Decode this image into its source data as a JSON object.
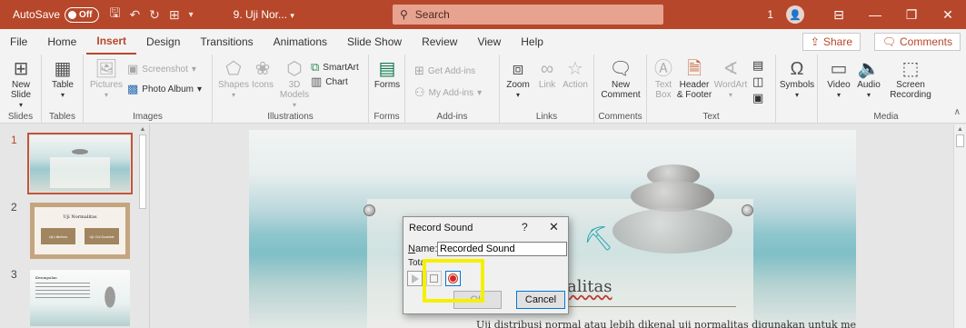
{
  "titlebar": {
    "autosave_label": "AutoSave",
    "autosave_state": "Off",
    "doc_title": "9. Uji Nor...",
    "search_placeholder": "Search",
    "notification_count": "1",
    "bg_color": "#b7472a"
  },
  "tabs": [
    "File",
    "Home",
    "Insert",
    "Design",
    "Transitions",
    "Animations",
    "Slide Show",
    "Review",
    "View",
    "Help"
  ],
  "active_tab": "Insert",
  "share_label": "Share",
  "comments_label": "Comments",
  "ribbon": {
    "groups": {
      "slides": "Slides",
      "tables": "Tables",
      "images": "Images",
      "illustrations": "Illustrations",
      "forms": "Forms",
      "addins": "Add-ins",
      "links": "Links",
      "comments": "Comments",
      "text": "Text",
      "media": "Media"
    },
    "new_slide": "New Slide",
    "table": "Table",
    "pictures": "Pictures",
    "screenshot": "Screenshot",
    "photo_album": "Photo Album",
    "shapes": "Shapes",
    "icons": "Icons",
    "models_3d": "3D Models",
    "smartart": "SmartArt",
    "chart": "Chart",
    "forms": "Forms",
    "get_addins": "Get Add-ins",
    "my_addins": "My Add-ins",
    "zoom": "Zoom",
    "link": "Link",
    "action": "Action",
    "new_comment": "New Comment",
    "text_box": "Text Box",
    "header_footer": "Header & Footer",
    "wordart": "WordArt",
    "symbols": "Symbols",
    "video": "Video",
    "audio": "Audio",
    "screen_recording": "Screen Recording"
  },
  "slides_pane": {
    "numbers": [
      "1",
      "2",
      "3"
    ],
    "thumb2_title": "Uji Normalitas",
    "thumb2_btn1": "Uji Lilliefors",
    "thumb2_btn2": "Uji Chi Kuadrat",
    "thumb3_title": "Kesimpulan"
  },
  "slide": {
    "title": "alitas",
    "body": "Uji distribusi normal atau lebih dikenal uji normalitas digunakan untuk mengukur"
  },
  "dialog": {
    "title": "Record Sound",
    "help": "?",
    "close": "✕",
    "name_label_prefix": "N",
    "name_label_rest": "ame:",
    "name_value": "Recorded Sound",
    "total_label": "Tota",
    "ok_label": "OK",
    "cancel_label": "Cancel"
  }
}
